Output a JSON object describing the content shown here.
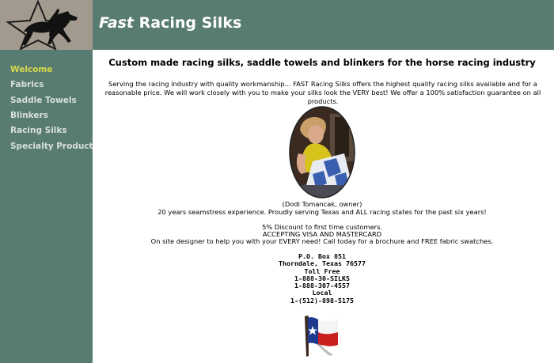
{
  "header": {
    "title_emphasis": "Fast",
    "title_rest": "Racing Silks",
    "logo_icon": "horse-star-logo"
  },
  "sidebar": {
    "items": [
      {
        "label": "Welcome",
        "active": true
      },
      {
        "label": "Fabrics",
        "active": false
      },
      {
        "label": "Saddle Towels",
        "active": false
      },
      {
        "label": "Blinkers",
        "active": false
      },
      {
        "label": "Racing Silks",
        "active": false
      },
      {
        "label": "Specialty Products",
        "active": false
      }
    ]
  },
  "main": {
    "headline": "Custom made racing  silks, saddle towels and blinkers for the horse racing industry",
    "intro": "Serving the racing industry with quality workmanship... FAST Racing Silks offers the highest quality racing silks available and for a reasonable price. We will work closely with you to make your silks look the VERY best! We offer a 100% satisfaction guarantee on all products.",
    "caption": "(Dodi Tomancak, owner)",
    "experience": "20 years seamstress experience. Proudly serving Texas and ALL racing states for the past six years!",
    "discount": "5% Discount to first time customers.",
    "payment": "ACCEPTING VISA AND MASTERCARD",
    "designer": "On site designer to help you with your EVERY need! Call today for a brochure and FREE fabric swatches.",
    "contact": {
      "po_box": "P.O. Box 851",
      "city": "Thorndale, Texas 76577",
      "toll_free_label": "Toll Free",
      "toll_free_1": "1-888-30-SILKS",
      "toll_free_2": "1-888-307-4557",
      "local_label": "Local",
      "local": "1-(512)-898-5175"
    },
    "photo_icon": "owner-photo",
    "flag_icon": "texas-flag-icon"
  },
  "colors": {
    "header_bg": "#587b72",
    "logo_bg": "#a39a8f",
    "nav_active": "#d8d94a",
    "nav_text": "#d8dfdc"
  }
}
